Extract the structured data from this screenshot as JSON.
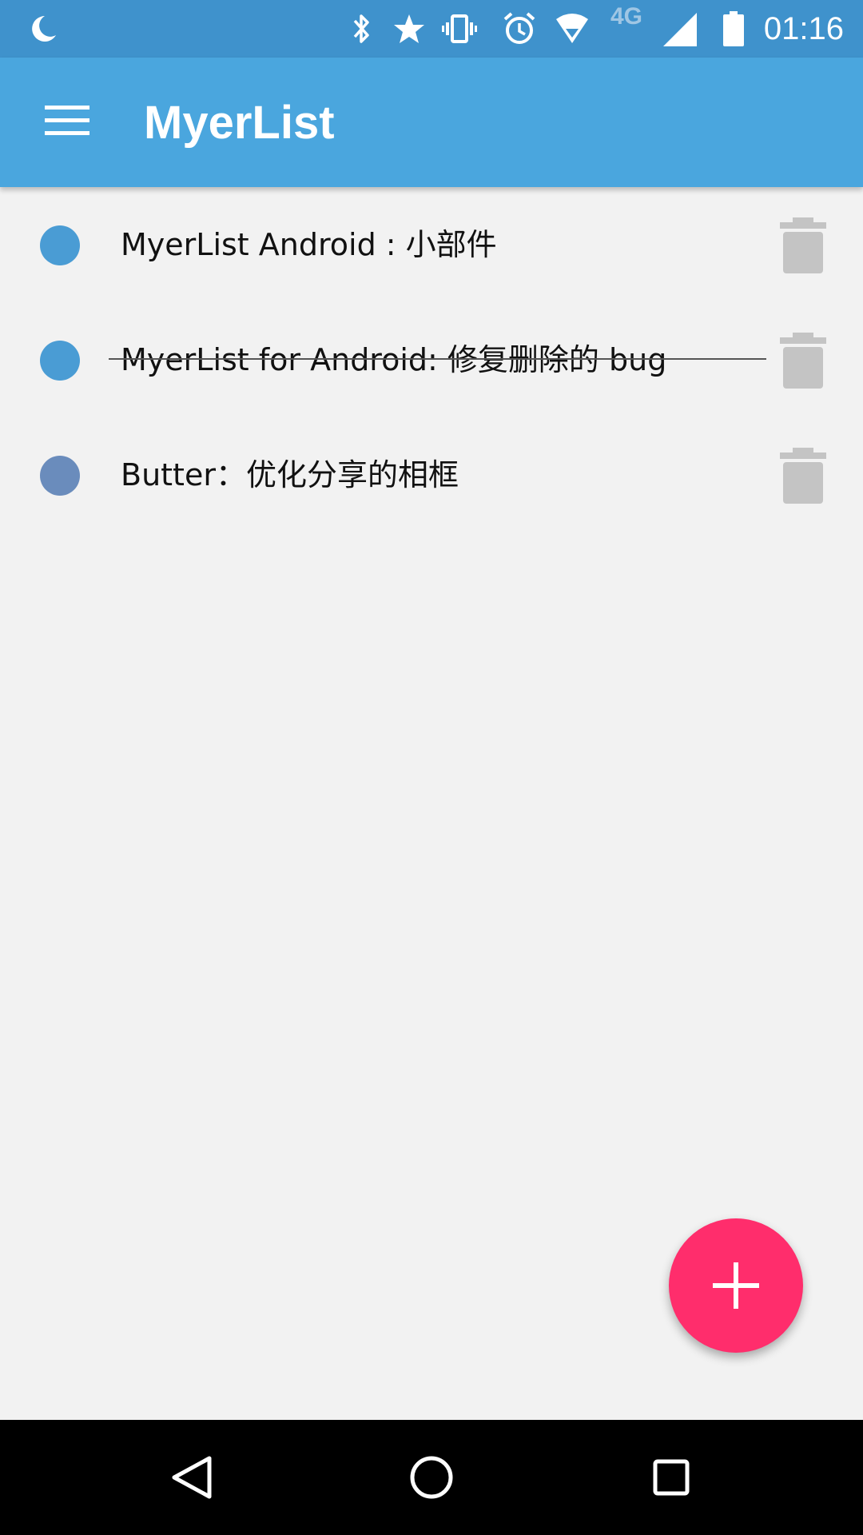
{
  "status_bar": {
    "time": "01:16",
    "network_label": "4G",
    "icons": [
      "moon-icon",
      "bluetooth-icon",
      "star-icon",
      "vibrate-icon",
      "alarm-icon",
      "wifi-icon",
      "cell-signal-icon",
      "battery-icon"
    ]
  },
  "app_bar": {
    "title": "MyerList",
    "menu_icon": "hamburger-menu-icon"
  },
  "tasks": [
    {
      "text": "MyerList Android : 小部件",
      "completed": false,
      "color": "#4a9cd4"
    },
    {
      "text": "MyerList for Android: 修复删除的 bug",
      "completed": true,
      "color": "#4a9cd4"
    },
    {
      "text": "Butter：优化分享的相框",
      "completed": false,
      "color": "#6a8cbc"
    }
  ],
  "fab": {
    "icon": "plus-icon",
    "color": "#ff2d6c"
  },
  "nav_bar": {
    "icons": [
      "back-icon",
      "home-icon",
      "recents-icon"
    ]
  },
  "colors": {
    "status_bar": "#3f92cc",
    "app_bar": "#4aa6de",
    "background": "#f2f2f2",
    "trash": "#c4c4c4"
  }
}
